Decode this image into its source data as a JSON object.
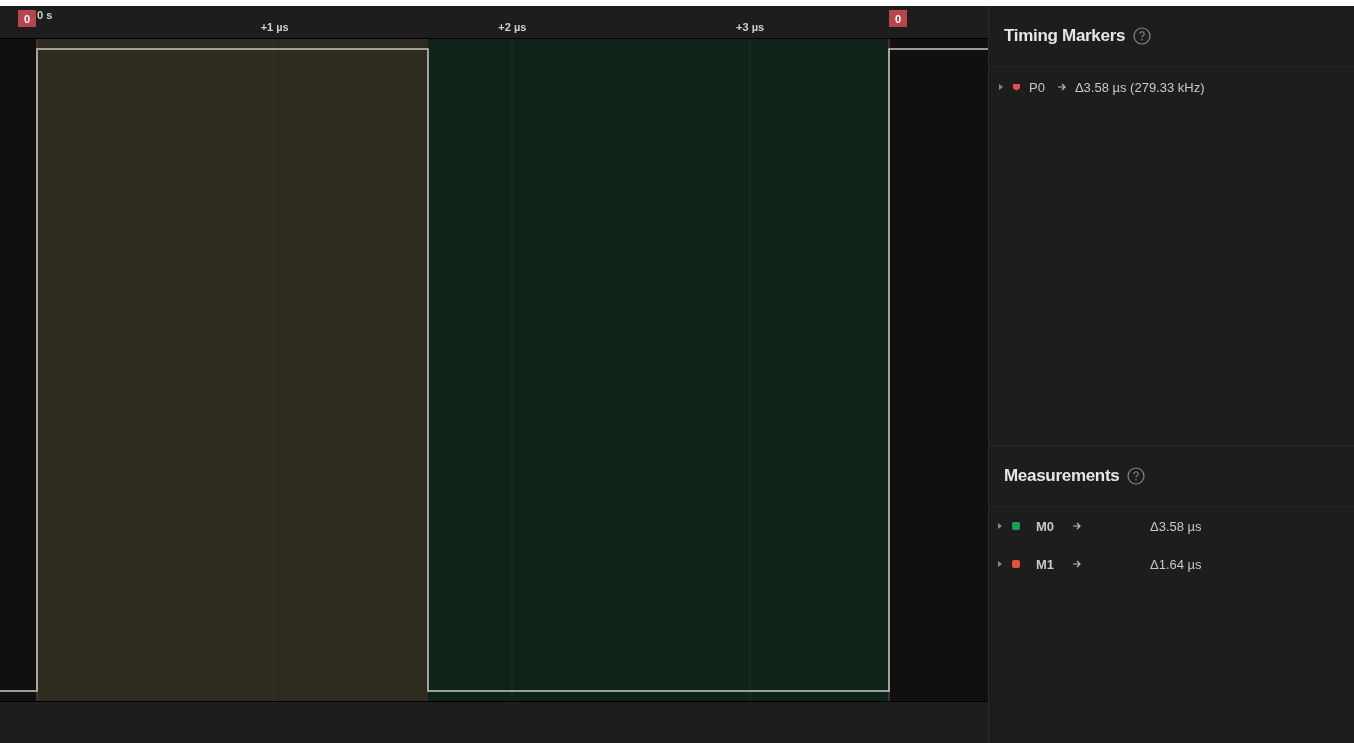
{
  "timeline": {
    "ticks": [
      "0 s",
      "+1 µs",
      "+2 µs",
      "+3 µs"
    ],
    "markers": [
      "0",
      "0"
    ]
  },
  "timing_markers": {
    "title": "Timing Markers",
    "items": [
      {
        "name": "P0",
        "value": "Δ3.58 µs (279.33 kHz)",
        "color": "#e84a4a",
        "expanded": false
      }
    ]
  },
  "measurements": {
    "title": "Measurements",
    "items": [
      {
        "name": "M0",
        "value": "Δ3.58 µs",
        "color": "#1aa150",
        "expanded": false
      },
      {
        "name": "M1",
        "value": "Δ1.64 µs",
        "color": "#e0503a",
        "expanded": false
      }
    ]
  }
}
